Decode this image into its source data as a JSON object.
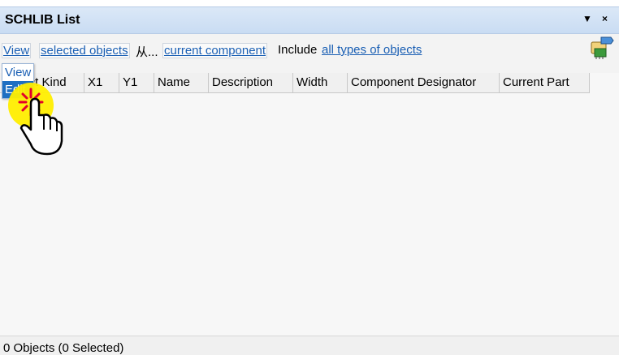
{
  "panel": {
    "title": "SCHLIB List",
    "menu_glyph": "▼",
    "close_glyph": "×"
  },
  "toolbar": {
    "mode_label": "View",
    "scope_label": "selected objects",
    "from_label": "从...",
    "source_label": "current component",
    "include_label": "Include",
    "filter_label": "all types of objects",
    "icon": "component-filter-icon"
  },
  "mode_dropdown": {
    "options": [
      "View",
      "Edit"
    ],
    "highlighted": "Edit"
  },
  "columns": [
    "Object Kind",
    "X1",
    "Y1",
    "Name",
    "Description",
    "Width",
    "Component Designator",
    "Current Part"
  ],
  "status": {
    "text": "0 Objects (0 Selected)"
  },
  "cursor": {
    "icon": "hand-pointer-icon",
    "highlight_color": "#ffee00",
    "click_color": "#e4002b"
  }
}
